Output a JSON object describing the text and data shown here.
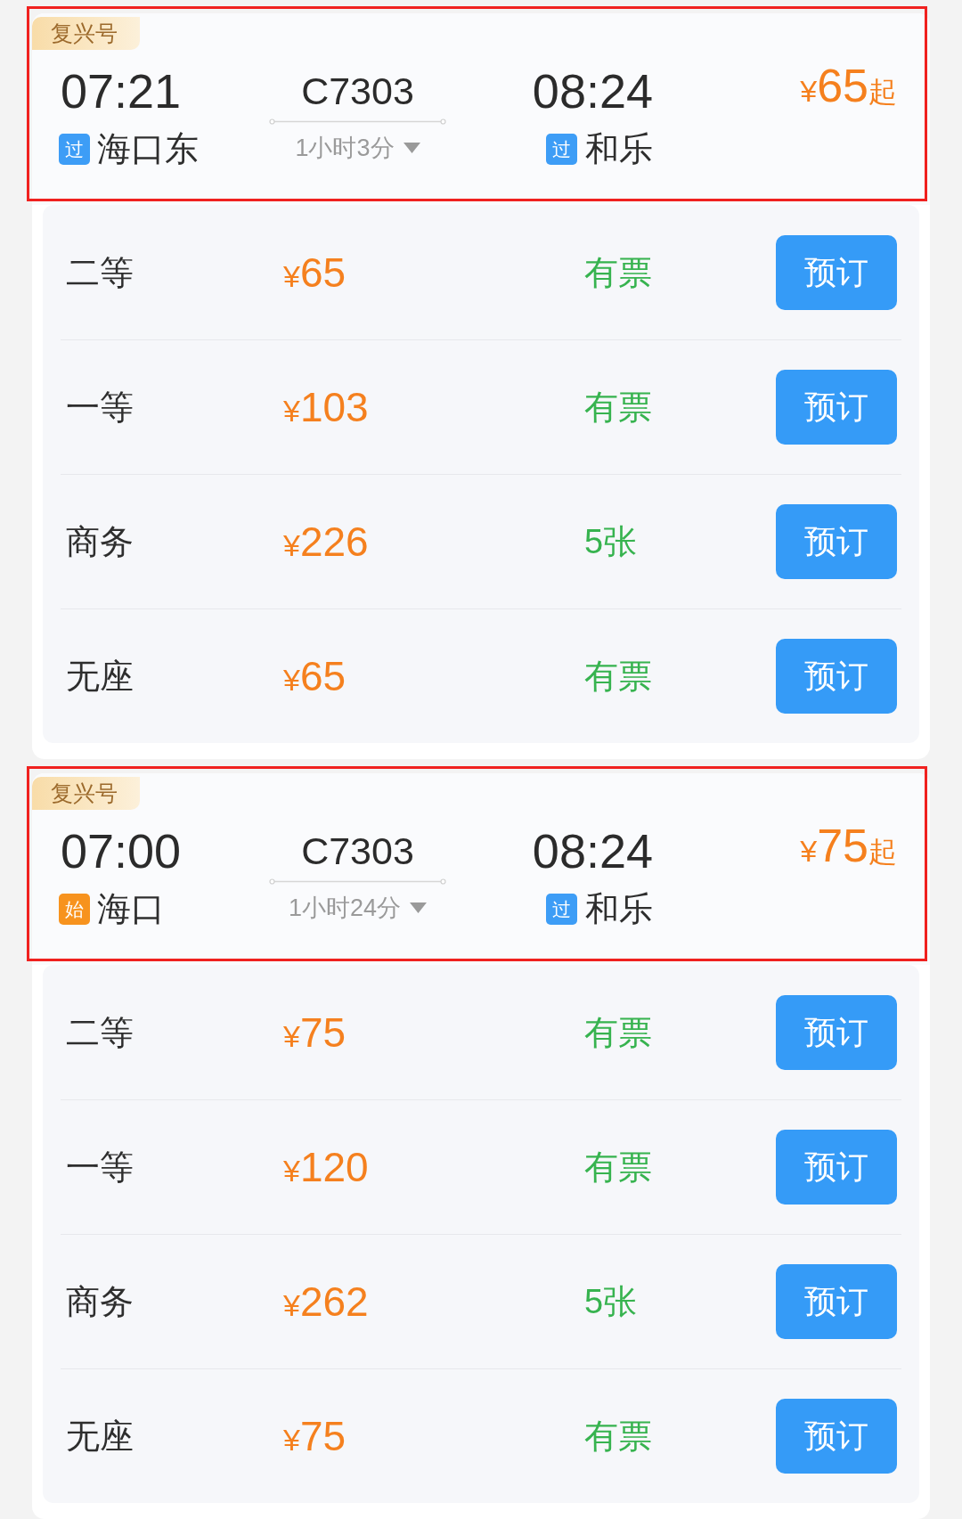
{
  "trains": [
    {
      "highlighted": true,
      "brand": "复兴号",
      "depart_time": "07:21",
      "train_no": "C7303",
      "duration": "1小时3分",
      "arrive_time": "08:24",
      "from": {
        "tag": {
          "text": "过",
          "kind": "pass"
        },
        "station": "海口东"
      },
      "to": {
        "tag": {
          "text": "过",
          "kind": "pass"
        },
        "station": "和乐"
      },
      "lowest_price": {
        "currency": "¥",
        "amount": "65",
        "suffix": "起"
      },
      "seats": [
        {
          "class": "二等",
          "currency": "¥",
          "price": "65",
          "availability": "有票",
          "button": "预订"
        },
        {
          "class": "一等",
          "currency": "¥",
          "price": "103",
          "availability": "有票",
          "button": "预订"
        },
        {
          "class": "商务",
          "currency": "¥",
          "price": "226",
          "availability": "5张",
          "button": "预订"
        },
        {
          "class": "无座",
          "currency": "¥",
          "price": "65",
          "availability": "有票",
          "button": "预订"
        }
      ]
    },
    {
      "highlighted": true,
      "brand": "复兴号",
      "depart_time": "07:00",
      "train_no": "C7303",
      "duration": "1小时24分",
      "arrive_time": "08:24",
      "from": {
        "tag": {
          "text": "始",
          "kind": "origin"
        },
        "station": "海口"
      },
      "to": {
        "tag": {
          "text": "过",
          "kind": "pass"
        },
        "station": "和乐"
      },
      "lowest_price": {
        "currency": "¥",
        "amount": "75",
        "suffix": "起"
      },
      "seats": [
        {
          "class": "二等",
          "currency": "¥",
          "price": "75",
          "availability": "有票",
          "button": "预订"
        },
        {
          "class": "一等",
          "currency": "¥",
          "price": "120",
          "availability": "有票",
          "button": "预订"
        },
        {
          "class": "商务",
          "currency": "¥",
          "price": "262",
          "availability": "5张",
          "button": "预订"
        },
        {
          "class": "无座",
          "currency": "¥",
          "price": "75",
          "availability": "有票",
          "button": "预订"
        }
      ]
    }
  ]
}
